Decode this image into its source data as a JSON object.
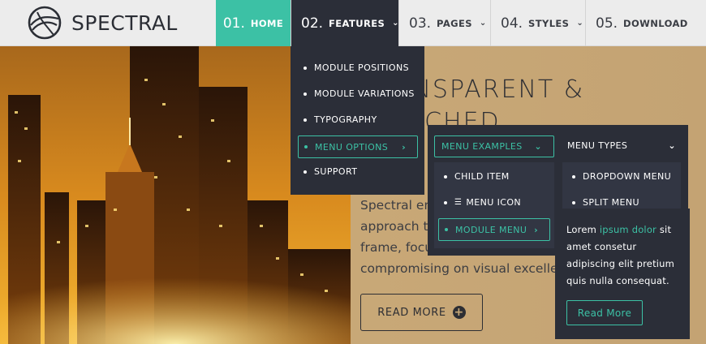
{
  "brand": {
    "name": "SPECTRAL",
    "logo_icon": "spectral-orb-icon"
  },
  "nav": [
    {
      "num": "01.",
      "label": "HOME",
      "has_chevron": false,
      "state": "active"
    },
    {
      "num": "02.",
      "label": "FEATURES",
      "has_chevron": true,
      "state": "open"
    },
    {
      "num": "03.",
      "label": "PAGES",
      "has_chevron": true,
      "state": ""
    },
    {
      "num": "04.",
      "label": "STYLES",
      "has_chevron": true,
      "state": ""
    },
    {
      "num": "05.",
      "label": "DOWNLOAD",
      "has_chevron": false,
      "state": ""
    }
  ],
  "hero": {
    "headline_line1": "TRANSPARENT &",
    "headline_line2": "ENRICHED",
    "body": "Spectral embraces a unique\napproach to its design\nframe, focusing on content without\ncompromising on visual excellence",
    "read_more": "READ MORE"
  },
  "features_menu": {
    "items": [
      "MODULE POSITIONS",
      "MODULE VARIATIONS",
      "TYPOGRAPHY",
      "MENU OPTIONS",
      "SUPPORT"
    ],
    "highlighted_index": 3
  },
  "menu_options_panel": {
    "col1_header": "MENU EXAMPLES",
    "col2_header": "MENU TYPES",
    "col1_items": [
      "CHILD ITEM",
      "MENU ICON",
      "MODULE MENU"
    ],
    "col2_items": [
      "DROPDOWN MENU",
      "SPLIT MENU"
    ]
  },
  "module_menu_panel": {
    "text_start": "Lorem ",
    "text_accent": "ipsum dolor",
    "text_end": " sit amet consetur adipiscing elit pretium quis nulla consequat.",
    "button": "Read More"
  },
  "colors": {
    "accent": "#3cc1a5",
    "dark": "#2b2e38",
    "header_bg": "#ececec"
  }
}
